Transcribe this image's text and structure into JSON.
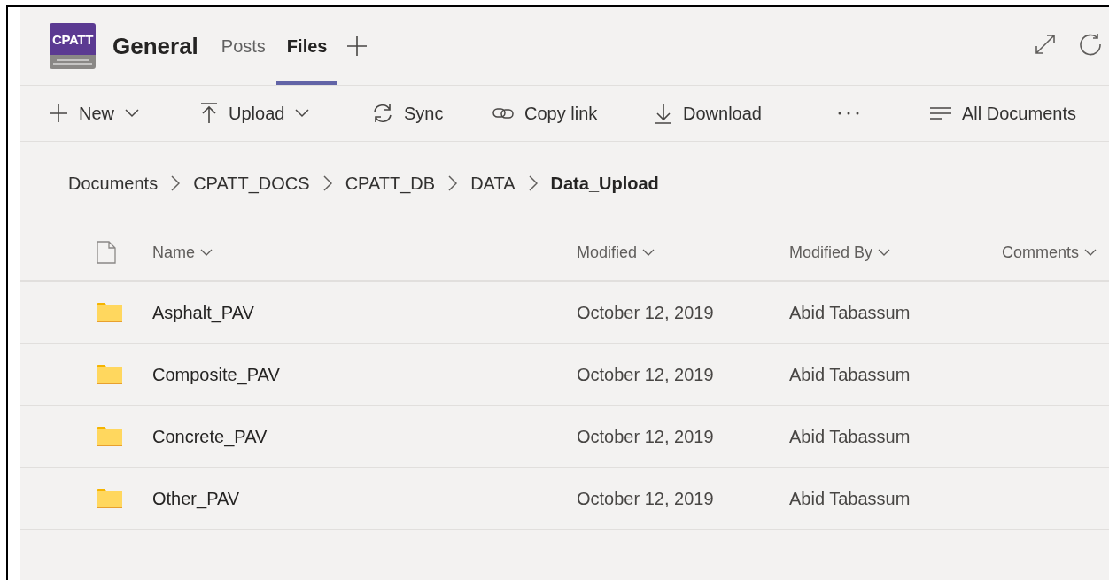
{
  "logo": {
    "name": "CPATT"
  },
  "channel": {
    "title": "General"
  },
  "tabs": [
    {
      "label": "Posts",
      "selected": false
    },
    {
      "label": "Files",
      "selected": true
    }
  ],
  "toolbar": [
    {
      "kind": "new",
      "label": "New",
      "dropdown": true
    },
    {
      "kind": "upload",
      "label": "Upload",
      "dropdown": true
    },
    {
      "kind": "sync",
      "label": "Sync",
      "dropdown": false
    },
    {
      "kind": "link",
      "label": "Copy link",
      "dropdown": false
    },
    {
      "kind": "download",
      "label": "Download",
      "dropdown": false
    }
  ],
  "view": {
    "label": "All Documents"
  },
  "breadcrumb": [
    {
      "label": "Documents",
      "current": false
    },
    {
      "label": "CPATT_DOCS",
      "current": false
    },
    {
      "label": "CPATT_DB",
      "current": false
    },
    {
      "label": "DATA",
      "current": false
    },
    {
      "label": "Data_Upload",
      "current": true
    }
  ],
  "table": {
    "columns": [
      "Name",
      "Modified",
      "Modified By",
      "Comments"
    ],
    "rows": [
      {
        "name": "Asphalt_PAV",
        "modified": "October 12, 2019",
        "modified_by": "Abid Tabassum"
      },
      {
        "name": "Composite_PAV",
        "modified": "October 12, 2019",
        "modified_by": "Abid Tabassum"
      },
      {
        "name": "Concrete_PAV",
        "modified": "October 12, 2019",
        "modified_by": "Abid Tabassum"
      },
      {
        "name": "Other_PAV",
        "modified": "October 12, 2019",
        "modified_by": "Abid Tabassum"
      }
    ]
  }
}
